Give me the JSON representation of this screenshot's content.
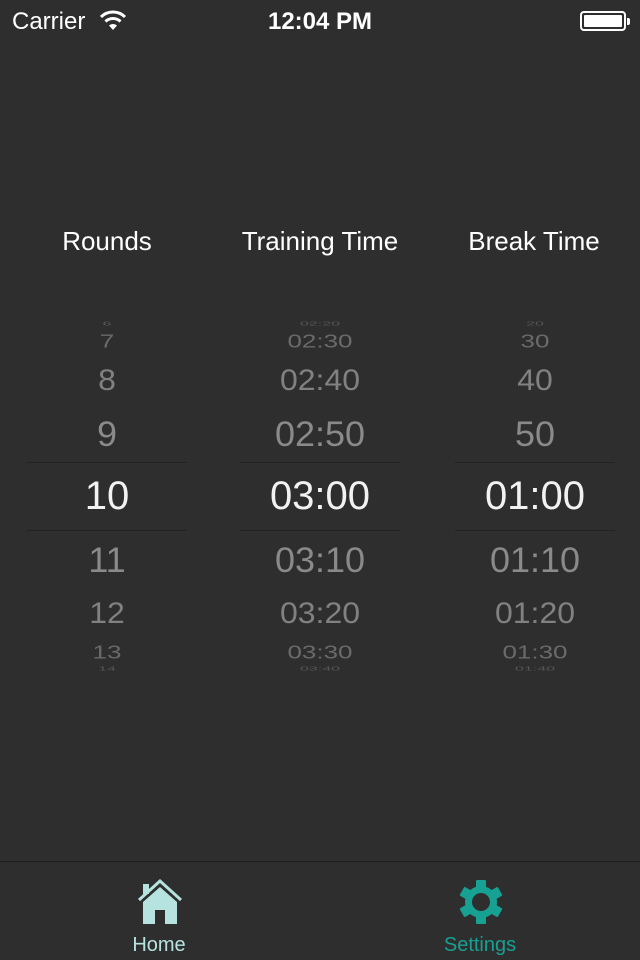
{
  "status_bar": {
    "carrier": "Carrier",
    "time": "12:04 PM",
    "icons": [
      "wifi-icon",
      "battery-icon"
    ]
  },
  "columns": [
    {
      "id": "rounds",
      "header": "Rounds",
      "items": [
        "6",
        "7",
        "8",
        "9",
        "10",
        "11",
        "12",
        "13",
        "14"
      ],
      "selected": "10"
    },
    {
      "id": "training",
      "header": "Training Time",
      "items": [
        "02:20",
        "02:30",
        "02:40",
        "02:50",
        "03:00",
        "03:10",
        "03:20",
        "03:30",
        "03:40"
      ],
      "selected": "03:00"
    },
    {
      "id": "break",
      "header": "Break Time",
      "items": [
        "20",
        "30",
        "40",
        "50",
        "01:00",
        "01:10",
        "01:20",
        "01:30",
        "01:40"
      ],
      "selected": "01:00"
    }
  ],
  "tab_bar": {
    "tabs": [
      {
        "label": "Home",
        "icon": "home-icon",
        "active": false,
        "color": "#b6e3df"
      },
      {
        "label": "Settings",
        "icon": "gear-icon",
        "active": true,
        "color": "#16a192"
      }
    ]
  },
  "colors": {
    "background": "#2e2e2e",
    "accent": "#16a192",
    "inactive_tab": "#b6e3df",
    "picker_text": "#8a8a8a",
    "picker_selected": "#f2f2f2"
  }
}
